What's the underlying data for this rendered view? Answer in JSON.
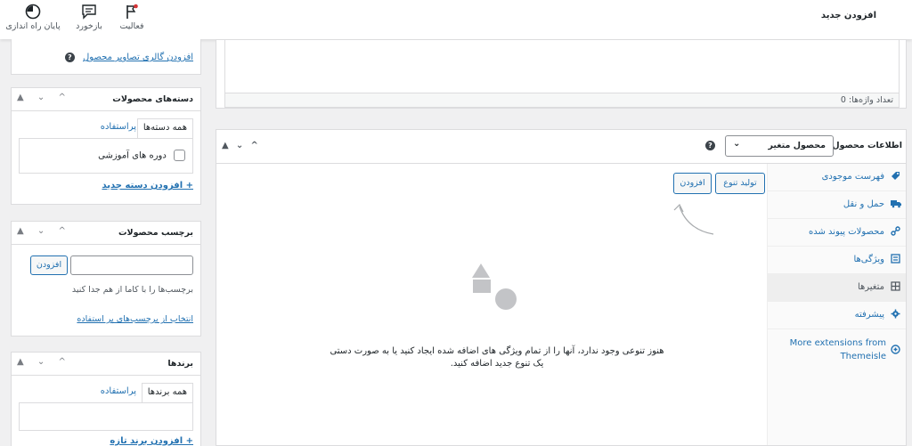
{
  "header": {
    "title": "افزودن جدید",
    "actions": [
      {
        "label": "فعالیت",
        "icon": "flag-icon"
      },
      {
        "label": "بازخورد",
        "icon": "feedback-icon"
      },
      {
        "label": "پایان راه اندازی",
        "icon": "progress-icon"
      }
    ]
  },
  "editor": {
    "word_count": "تعداد واژه‌ها: 0"
  },
  "gallery": {
    "add_link": "افزودن گالری تصاویر محصول"
  },
  "categories": {
    "title": "دسته‌های محصولات",
    "tab_all": "همه دسته‌ها",
    "tab_popular": "پراستفاده",
    "items": [
      {
        "label": "دوره های آموزشی",
        "checked": false
      }
    ],
    "add_link": "+ افزودن دسته جدید"
  },
  "tags": {
    "title": "برچسب محصولات",
    "input_value": "",
    "add_button": "افزودن",
    "hint": "برچسب‌ها را با کاما از هم جدا کنید",
    "choose_link": "انتخاب از برچسب‌های پر استفاده"
  },
  "brands": {
    "title": "برندها",
    "tab_all": "همه برندها",
    "tab_popular": "پراستفاده",
    "add_link": "+ افزودن برند تازه"
  },
  "product_data": {
    "title": "اطلاعات محصول —",
    "type_select": "محصول متغیر",
    "tabs": [
      {
        "label": "فهرست موجودی",
        "icon": "inventory-icon"
      },
      {
        "label": "حمل و نقل",
        "icon": "truck-icon"
      },
      {
        "label": "محصولات پیوند شده",
        "icon": "link-icon"
      },
      {
        "label": "ویژگی‌ها",
        "icon": "attributes-icon"
      },
      {
        "label": "متغیرها",
        "icon": "grid-icon",
        "active": true
      },
      {
        "label": "پیشرفته",
        "icon": "gear-icon"
      },
      {
        "label": "More extensions from Themeisle",
        "icon": "plugin-icon"
      }
    ],
    "generate_button": "تولید تنوع",
    "add_button": "افزودن",
    "empty_line1": "هنوز تنوعی وجود ندارد، آنها را از تمام ویژگی های اضافه شده ایجاد کنید یا به صورت دستی",
    "empty_line2": "یک تنوع جدید اضافه کنید."
  }
}
